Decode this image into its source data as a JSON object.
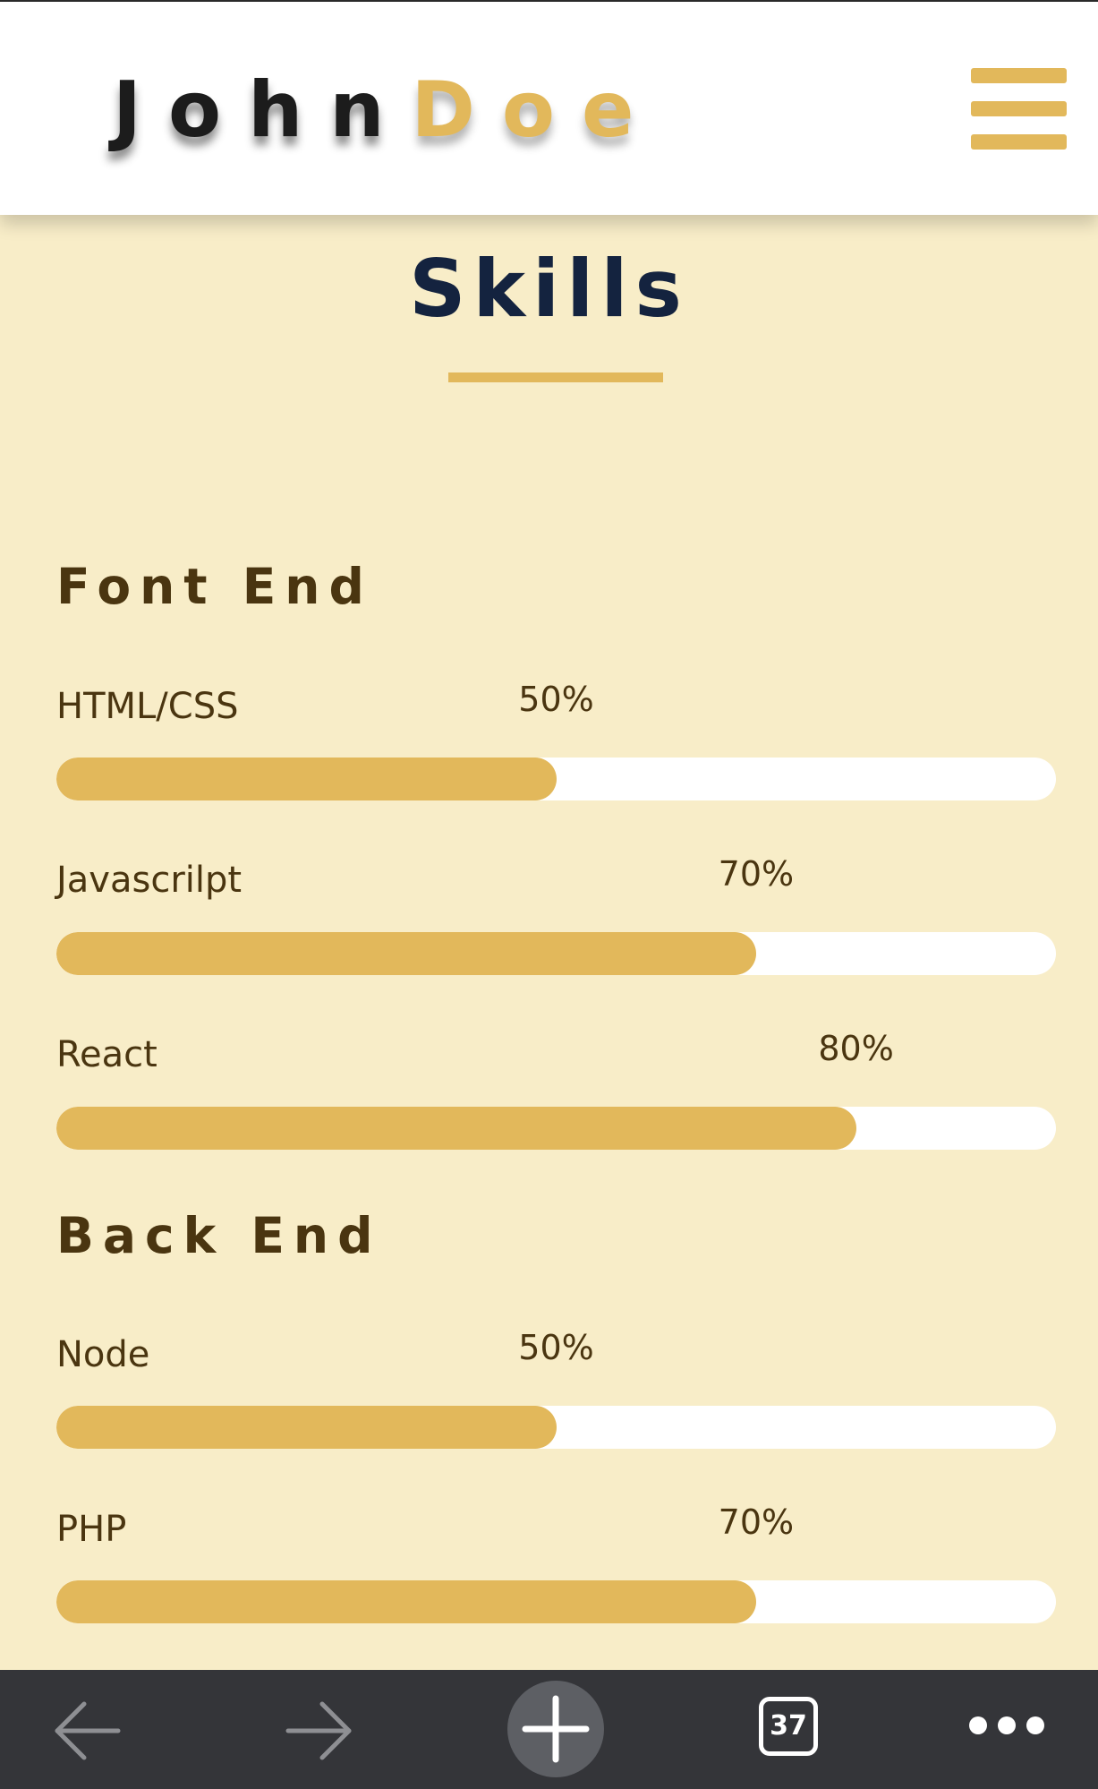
{
  "header": {
    "logo_first": "John",
    "logo_last": "Doe",
    "menu_icon": "hamburger-menu-icon"
  },
  "skills": {
    "title": "Skills",
    "groups": [
      {
        "heading": "Font End",
        "items": [
          {
            "name": "HTML/CSS",
            "percent_label": "50%",
            "level": 0.5
          },
          {
            "name": "Javascrilpt",
            "percent_label": "70%",
            "level": 0.7
          },
          {
            "name": "React",
            "percent_label": "80%",
            "level": 0.8
          }
        ]
      },
      {
        "heading": "Back End",
        "items": [
          {
            "name": "Node",
            "percent_label": "50%",
            "level": 0.5
          },
          {
            "name": "PHP",
            "percent_label": "70%",
            "level": 0.7
          }
        ]
      }
    ]
  },
  "browser_toolbar": {
    "back_icon": "arrow-left-icon",
    "forward_icon": "arrow-right-icon",
    "new_tab_icon": "plus-icon",
    "tab_count": "37",
    "more_icon": "more-dots-icon"
  },
  "colors": {
    "accent": "#e2b85b",
    "page_background": "#f8edc8",
    "title": "#14233f",
    "text": "#4a3510",
    "toolbar": "#343539"
  }
}
